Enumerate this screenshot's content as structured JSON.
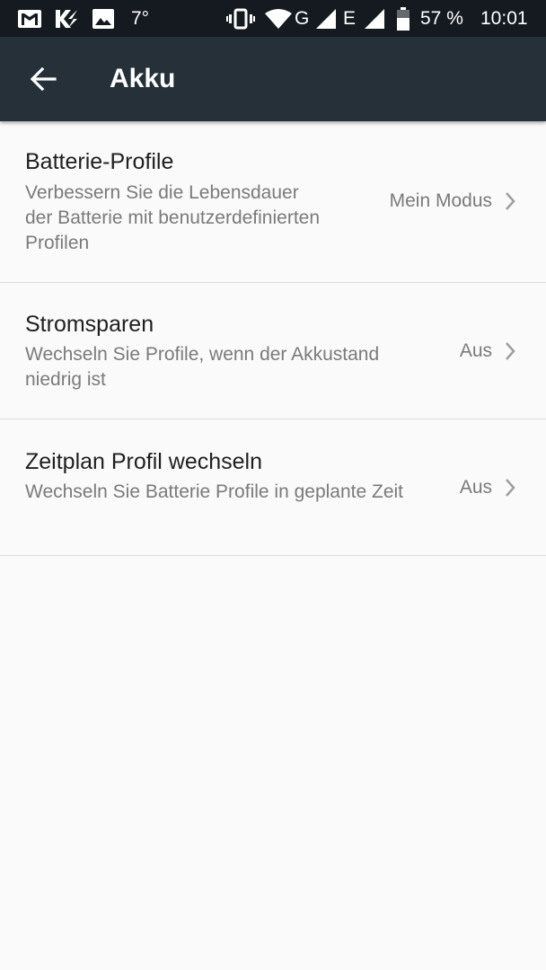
{
  "status_bar": {
    "temperature": "7°",
    "network_g": "G",
    "network_e": "E",
    "battery_percent": "57 %",
    "time": "10:01",
    "icons": [
      "gmail-icon",
      "flash-app-icon",
      "image-icon",
      "vibrate-icon",
      "wifi-icon",
      "signal-icon",
      "signal-icon-2",
      "battery-icon"
    ]
  },
  "app_bar": {
    "back_icon": "arrow-back-icon",
    "title": "Akku",
    "background": "#263038"
  },
  "settings": [
    {
      "title": "Batterie-Profile",
      "summary": "Verbessern Sie die Lebensdauer der Batterie mit benutzerdefinierten Profilen",
      "value": "Mein Modus",
      "icon": "chevron-right-icon"
    },
    {
      "title": "Stromsparen",
      "summary": "Wechseln Sie Profile, wenn der Akkustand niedrig ist",
      "value": "Aus",
      "icon": "chevron-right-icon"
    },
    {
      "title": "Zeitplan Profil wechseln",
      "summary": "Wechseln Sie Batterie Profile in geplante Zeit",
      "value": "Aus",
      "icon": "chevron-right-icon"
    }
  ]
}
